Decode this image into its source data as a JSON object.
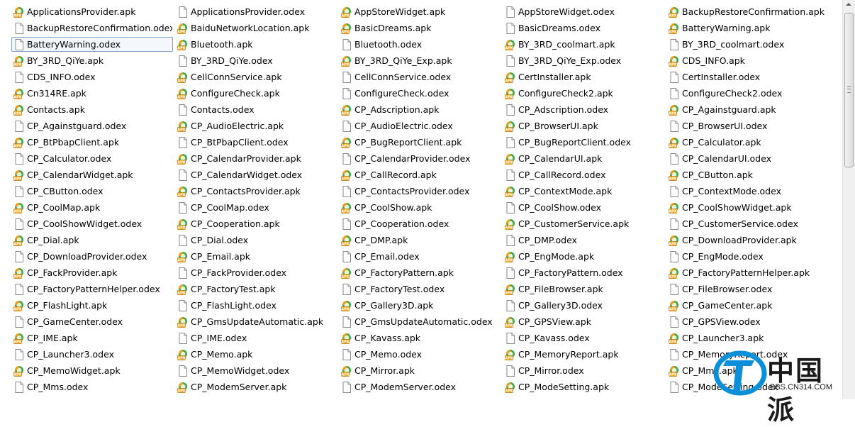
{
  "colors": {
    "apk_green": "#2f9e2f",
    "apk_orange": "#f0a020",
    "selection_border": "#7da2ce"
  },
  "icons": {
    "apk": "apk-file-icon",
    "odex": "odex-file-icon"
  },
  "files": [
    {
      "name": "ApplicationsProvider.apk",
      "type": "apk"
    },
    {
      "name": "BackupRestoreConfirmation.odex",
      "type": "odex"
    },
    {
      "name": "BatteryWarning.odex",
      "type": "odex",
      "selected": true
    },
    {
      "name": "BY_3RD_QiYe.apk",
      "type": "apk"
    },
    {
      "name": "CDS_INFO.odex",
      "type": "odex"
    },
    {
      "name": "Cn314RE.apk",
      "type": "apk"
    },
    {
      "name": "Contacts.apk",
      "type": "apk"
    },
    {
      "name": "CP_Againstguard.odex",
      "type": "odex"
    },
    {
      "name": "CP_BtPbapClient.apk",
      "type": "apk"
    },
    {
      "name": "CP_Calculator.odex",
      "type": "odex"
    },
    {
      "name": "CP_CalendarWidget.apk",
      "type": "apk"
    },
    {
      "name": "CP_CButton.odex",
      "type": "odex"
    },
    {
      "name": "CP_CoolMap.apk",
      "type": "apk"
    },
    {
      "name": "CP_CoolShowWidget.odex",
      "type": "odex"
    },
    {
      "name": "CP_Dial.apk",
      "type": "apk"
    },
    {
      "name": "CP_DownloadProvider.odex",
      "type": "odex"
    },
    {
      "name": "CP_FackProvider.apk",
      "type": "apk"
    },
    {
      "name": "CP_FactoryPatternHelper.odex",
      "type": "odex"
    },
    {
      "name": "CP_FlashLight.apk",
      "type": "apk"
    },
    {
      "name": "CP_GameCenter.odex",
      "type": "odex"
    },
    {
      "name": "CP_IME.apk",
      "type": "apk"
    },
    {
      "name": "CP_Launcher3.odex",
      "type": "odex"
    },
    {
      "name": "CP_MemoWidget.apk",
      "type": "apk"
    },
    {
      "name": "CP_Mms.odex",
      "type": "odex"
    },
    {
      "name": "ApplicationsProvider.odex",
      "type": "odex"
    },
    {
      "name": "BaiduNetworkLocation.apk",
      "type": "apk"
    },
    {
      "name": "Bluetooth.apk",
      "type": "apk"
    },
    {
      "name": "BY_3RD_QiYe.odex",
      "type": "odex"
    },
    {
      "name": "CellConnService.apk",
      "type": "apk"
    },
    {
      "name": "ConfigureCheck.apk",
      "type": "apk"
    },
    {
      "name": "Contacts.odex",
      "type": "odex"
    },
    {
      "name": "CP_AudioElectric.apk",
      "type": "apk"
    },
    {
      "name": "CP_BtPbapClient.odex",
      "type": "odex"
    },
    {
      "name": "CP_CalendarProvider.apk",
      "type": "apk"
    },
    {
      "name": "CP_CalendarWidget.odex",
      "type": "odex"
    },
    {
      "name": "CP_ContactsProvider.apk",
      "type": "apk"
    },
    {
      "name": "CP_CoolMap.odex",
      "type": "odex"
    },
    {
      "name": "CP_Cooperation.apk",
      "type": "apk"
    },
    {
      "name": "CP_Dial.odex",
      "type": "odex"
    },
    {
      "name": "CP_Email.apk",
      "type": "apk"
    },
    {
      "name": "CP_FackProvider.odex",
      "type": "odex"
    },
    {
      "name": "CP_FactoryTest.apk",
      "type": "apk"
    },
    {
      "name": "CP_FlashLight.odex",
      "type": "odex"
    },
    {
      "name": "CP_GmsUpdateAutomatic.apk",
      "type": "apk"
    },
    {
      "name": "CP_IME.odex",
      "type": "odex"
    },
    {
      "name": "CP_Memo.apk",
      "type": "apk"
    },
    {
      "name": "CP_MemoWidget.odex",
      "type": "odex"
    },
    {
      "name": "CP_ModemServer.apk",
      "type": "apk"
    },
    {
      "name": "AppStoreWidget.apk",
      "type": "apk"
    },
    {
      "name": "BasicDreams.apk",
      "type": "apk"
    },
    {
      "name": "Bluetooth.odex",
      "type": "odex"
    },
    {
      "name": "BY_3RD_QiYe_Exp.apk",
      "type": "apk"
    },
    {
      "name": "CellConnService.odex",
      "type": "odex"
    },
    {
      "name": "ConfigureCheck.odex",
      "type": "odex"
    },
    {
      "name": "CP_Adscription.apk",
      "type": "apk"
    },
    {
      "name": "CP_AudioElectric.odex",
      "type": "odex"
    },
    {
      "name": "CP_BugReportClient.apk",
      "type": "apk"
    },
    {
      "name": "CP_CalendarProvider.odex",
      "type": "odex"
    },
    {
      "name": "CP_CallRecord.apk",
      "type": "apk"
    },
    {
      "name": "CP_ContactsProvider.odex",
      "type": "odex"
    },
    {
      "name": "CP_CoolShow.apk",
      "type": "apk"
    },
    {
      "name": "CP_Cooperation.odex",
      "type": "odex"
    },
    {
      "name": "CP_DMP.apk",
      "type": "apk"
    },
    {
      "name": "CP_Email.odex",
      "type": "odex"
    },
    {
      "name": "CP_FactoryPattern.apk",
      "type": "apk"
    },
    {
      "name": "CP_FactoryTest.odex",
      "type": "odex"
    },
    {
      "name": "CP_Gallery3D.apk",
      "type": "apk"
    },
    {
      "name": "CP_GmsUpdateAutomatic.odex",
      "type": "odex"
    },
    {
      "name": "CP_Kavass.apk",
      "type": "apk"
    },
    {
      "name": "CP_Memo.odex",
      "type": "odex"
    },
    {
      "name": "CP_Mirror.apk",
      "type": "apk"
    },
    {
      "name": "CP_ModemServer.odex",
      "type": "odex"
    },
    {
      "name": "AppStoreWidget.odex",
      "type": "odex"
    },
    {
      "name": "BasicDreams.odex",
      "type": "odex"
    },
    {
      "name": "BY_3RD_coolmart.apk",
      "type": "apk"
    },
    {
      "name": "BY_3RD_QiYe_Exp.odex",
      "type": "odex"
    },
    {
      "name": "CertInstaller.apk",
      "type": "apk"
    },
    {
      "name": "ConfigureCheck2.apk",
      "type": "apk"
    },
    {
      "name": "CP_Adscription.odex",
      "type": "odex"
    },
    {
      "name": "CP_BrowserUI.apk",
      "type": "apk"
    },
    {
      "name": "CP_BugReportClient.odex",
      "type": "odex"
    },
    {
      "name": "CP_CalendarUI.apk",
      "type": "apk"
    },
    {
      "name": "CP_CallRecord.odex",
      "type": "odex"
    },
    {
      "name": "CP_ContextMode.apk",
      "type": "apk"
    },
    {
      "name": "CP_CoolShow.odex",
      "type": "odex"
    },
    {
      "name": "CP_CustomerService.apk",
      "type": "apk"
    },
    {
      "name": "CP_DMP.odex",
      "type": "odex"
    },
    {
      "name": "CP_EngMode.apk",
      "type": "apk"
    },
    {
      "name": "CP_FactoryPattern.odex",
      "type": "odex"
    },
    {
      "name": "CP_FileBrowser.apk",
      "type": "apk"
    },
    {
      "name": "CP_Gallery3D.odex",
      "type": "odex"
    },
    {
      "name": "CP_GPSView.apk",
      "type": "apk"
    },
    {
      "name": "CP_Kavass.odex",
      "type": "odex"
    },
    {
      "name": "CP_MemoryReport.apk",
      "type": "apk"
    },
    {
      "name": "CP_Mirror.odex",
      "type": "odex"
    },
    {
      "name": "CP_ModeSetting.apk",
      "type": "apk"
    },
    {
      "name": "BackupRestoreConfirmation.apk",
      "type": "apk"
    },
    {
      "name": "BatteryWarning.apk",
      "type": "apk"
    },
    {
      "name": "BY_3RD_coolmart.odex",
      "type": "odex"
    },
    {
      "name": "CDS_INFO.apk",
      "type": "apk"
    },
    {
      "name": "CertInstaller.odex",
      "type": "odex"
    },
    {
      "name": "ConfigureCheck2.odex",
      "type": "odex"
    },
    {
      "name": "CP_Againstguard.apk",
      "type": "apk"
    },
    {
      "name": "CP_BrowserUI.odex",
      "type": "odex"
    },
    {
      "name": "CP_Calculator.apk",
      "type": "apk"
    },
    {
      "name": "CP_CalendarUI.odex",
      "type": "odex"
    },
    {
      "name": "CP_CButton.apk",
      "type": "apk"
    },
    {
      "name": "CP_ContextMode.odex",
      "type": "odex"
    },
    {
      "name": "CP_CoolShowWidget.apk",
      "type": "apk"
    },
    {
      "name": "CP_CustomerService.odex",
      "type": "odex"
    },
    {
      "name": "CP_DownloadProvider.apk",
      "type": "apk"
    },
    {
      "name": "CP_EngMode.odex",
      "type": "odex"
    },
    {
      "name": "CP_FactoryPatternHelper.apk",
      "type": "apk"
    },
    {
      "name": "CP_FileBrowser.odex",
      "type": "odex"
    },
    {
      "name": "CP_GameCenter.apk",
      "type": "apk"
    },
    {
      "name": "CP_GPSView.odex",
      "type": "odex"
    },
    {
      "name": "CP_Launcher3.apk",
      "type": "apk"
    },
    {
      "name": "CP_MemoryReport.odex",
      "type": "odex"
    },
    {
      "name": "CP_Mms.apk",
      "type": "apk"
    },
    {
      "name": "CP_ModeSetting.odex",
      "type": "odex"
    }
  ],
  "watermark": {
    "text": "中国派",
    "url": "BBS.CN314.COM"
  }
}
